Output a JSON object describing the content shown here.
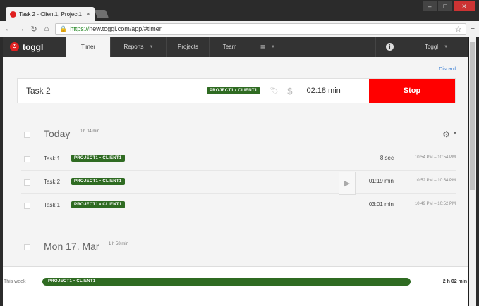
{
  "browser": {
    "tab_title": "Task 2 - Client1, Project1",
    "tab_close": "×",
    "url_https": "https://",
    "url_rest": "new.toggl.com/app/#timer",
    "window_controls": [
      "–",
      "□",
      "✕"
    ]
  },
  "nav": {
    "logo": "toggl",
    "items": [
      {
        "label": "Timer",
        "active": true
      },
      {
        "label": "Reports",
        "has_caret": true
      },
      {
        "label": "Projects"
      },
      {
        "label": "Team"
      }
    ],
    "user": "Toggl",
    "caret": "▼"
  },
  "timer": {
    "discard": "Discard",
    "description": "Task 2",
    "tag": "PROJECT1 • CLIENT1",
    "elapsed": "02:18 min",
    "stop": "Stop"
  },
  "days": [
    {
      "name": "Today",
      "total": "0 h 04 min",
      "entries": [
        {
          "desc": "Task 1",
          "tag": "PROJECT1 • CLIENT1",
          "duration": "8 sec",
          "range": "10:54 PM – 10:54 PM"
        },
        {
          "desc": "Task 2",
          "tag": "PROJECT1 • CLIENT1",
          "duration": "01:19 min",
          "range": "10:52 PM – 10:54 PM"
        },
        {
          "desc": "Task 1",
          "tag": "PROJECT1 • CLIENT1",
          "duration": "03:01 min",
          "range": "10:49 PM – 10:52 PM"
        }
      ]
    },
    {
      "name": "Mon 17. Mar",
      "total": "1 h 58 min"
    }
  ],
  "footer": {
    "label": "This week",
    "bar": "PROJECT1 • CLIENT1",
    "total": "2 h 02 min"
  },
  "colors": {
    "stop": "#ff0000",
    "tag": "#2f6b22",
    "nav": "#333333",
    "link": "#3b7fd4"
  }
}
